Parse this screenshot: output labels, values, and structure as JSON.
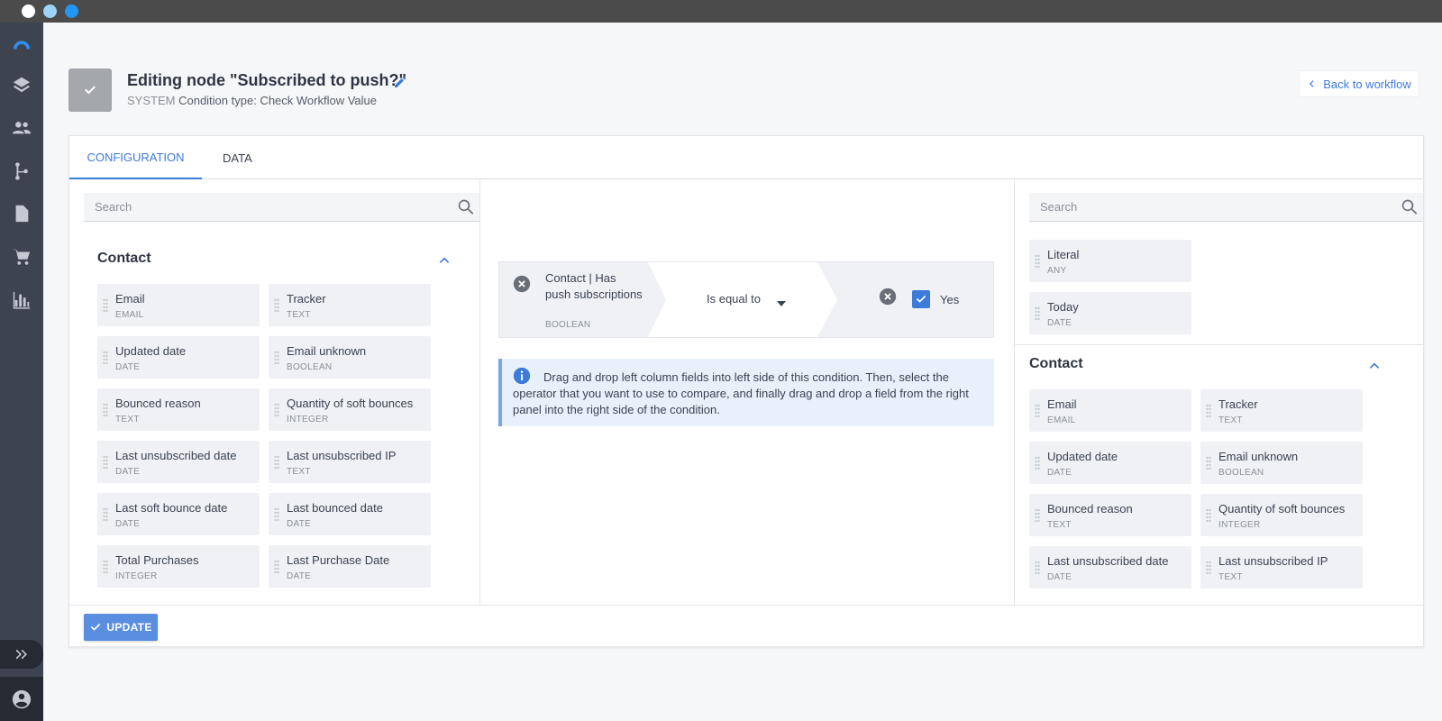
{
  "window": {
    "controls": [
      "close",
      "minimize",
      "maximize"
    ]
  },
  "rail": {
    "icons": [
      "logo-icon",
      "layers-icon",
      "contacts-icon",
      "workflow-icon",
      "document-icon",
      "cart-icon",
      "chart-icon"
    ],
    "bottom": [
      "expand-icon",
      "user-icon"
    ]
  },
  "header": {
    "title": "Editing node \"Subscribed to push?\"",
    "system_label": "SYSTEM",
    "condition_type": "Condition type: Check Workflow Value",
    "back_label": "Back to workflow"
  },
  "tabs": [
    {
      "label": "CONFIGURATION",
      "active": true
    },
    {
      "label": "DATA",
      "active": false
    }
  ],
  "left_panel": {
    "search_placeholder": "Search",
    "section": "Contact",
    "fields": [
      {
        "name": "Email",
        "type": "EMAIL"
      },
      {
        "name": "Tracker",
        "type": "TEXT"
      },
      {
        "name": "Updated date",
        "type": "DATE"
      },
      {
        "name": "Email unknown",
        "type": "BOOLEAN"
      },
      {
        "name": "Bounced reason",
        "type": "TEXT"
      },
      {
        "name": "Quantity of soft bounces",
        "type": "INTEGER"
      },
      {
        "name": "Last unsubscribed date",
        "type": "DATE"
      },
      {
        "name": "Last unsubscribed IP",
        "type": "TEXT"
      },
      {
        "name": "Last soft bounce date",
        "type": "DATE"
      },
      {
        "name": "Last bounced date",
        "type": "DATE"
      },
      {
        "name": "Total Purchases",
        "type": "INTEGER"
      },
      {
        "name": "Last Purchase Date",
        "type": "DATE"
      }
    ]
  },
  "condition": {
    "left_field": "Contact | Has push subscriptions",
    "left_type": "BOOLEAN",
    "operator": "Is equal to",
    "right_value": "Yes",
    "right_checked": true
  },
  "info": {
    "text": "Drag and drop left column fields into left side of this condition. Then, select the operator that you want to use to compare, and finally drag and drop a field from the right panel into the right side of the condition."
  },
  "right_panel": {
    "search_placeholder": "Search",
    "literals": [
      {
        "name": "Literal",
        "type": "ANY"
      },
      {
        "name": "Today",
        "type": "DATE"
      }
    ],
    "section": "Contact",
    "fields": [
      {
        "name": "Email",
        "type": "EMAIL"
      },
      {
        "name": "Tracker",
        "type": "TEXT"
      },
      {
        "name": "Updated date",
        "type": "DATE"
      },
      {
        "name": "Email unknown",
        "type": "BOOLEAN"
      },
      {
        "name": "Bounced reason",
        "type": "TEXT"
      },
      {
        "name": "Quantity of soft bounces",
        "type": "INTEGER"
      },
      {
        "name": "Last unsubscribed date",
        "type": "DATE"
      },
      {
        "name": "Last unsubscribed IP",
        "type": "TEXT"
      }
    ]
  },
  "footer": {
    "update_label": "UPDATE"
  },
  "colors": {
    "accent": "#3d7bd9",
    "rail": "#3d4450",
    "info_bg": "#e8f0fb"
  }
}
